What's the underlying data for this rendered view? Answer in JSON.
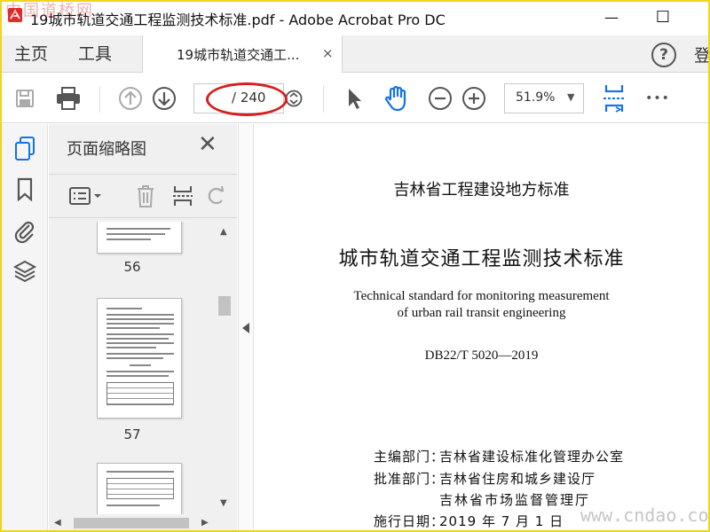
{
  "window": {
    "title": "19城市轨道交通工程监测技术标准.pdf - Adobe Acrobat Pro DC",
    "minimize_glyph": "—",
    "maximize_glyph": "☐"
  },
  "tabs": {
    "home_label": "主页",
    "tools_label": "工具",
    "document_tab_label": "19城市轨道交通工...",
    "document_tab_close": "×",
    "help_glyph": "?",
    "signin_label": "登"
  },
  "toolbar": {
    "page_current": "",
    "page_total": "/ 240",
    "zoom": "51.9%",
    "zoom_caret": "▼",
    "more_glyph": "•••"
  },
  "panel": {
    "title": "页面缩略图",
    "close_glyph": "✕",
    "thumbnails": [
      {
        "page": "56"
      },
      {
        "page": "57"
      },
      {
        "page": ""
      }
    ]
  },
  "document": {
    "header": "吉林省工程建设地方标准",
    "title_cn": "城市轨道交通工程监测技术标准",
    "title_en_line1": "Technical standard for monitoring measurement",
    "title_en_line2": "of urban rail transit engineering",
    "code": "DB22/T 5020—2019",
    "editor_label": "主编部门：",
    "editor_value": "吉林省建设标准化管理办公室",
    "approver_label": "批准部门：",
    "approver_value1": "吉林省住房和城乡建设厅",
    "approver_value2": "吉林省市场监督管理厅",
    "effective_label": "施行日期：",
    "effective_value": "2019 年 7 月 1 日"
  },
  "watermarks": {
    "top_left": "中国道桥网",
    "bottom_right": "www.cndao.com"
  },
  "colors": {
    "frame_border": "#f0d51c",
    "accent_blue": "#1473e6",
    "annotation_red": "#d71f1f"
  },
  "icons": [
    "save-icon",
    "print-icon",
    "page-up-icon",
    "page-down-icon",
    "page-nav-icon",
    "select-arrow-icon",
    "hand-tool-icon",
    "zoom-out-icon",
    "zoom-in-icon",
    "fit-page-icon",
    "more-icon",
    "thumbnails-icon",
    "bookmark-icon",
    "attachment-icon",
    "layers-icon"
  ]
}
